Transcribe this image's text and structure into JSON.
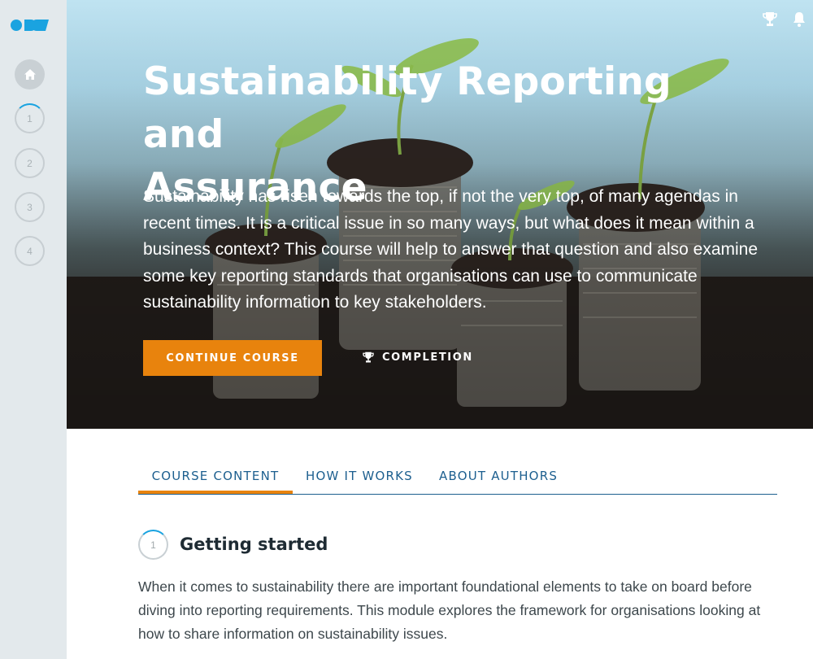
{
  "sidebar": {
    "logo": "logo",
    "home_icon": "home-icon",
    "steps": [
      "1",
      "2",
      "3",
      "4"
    ]
  },
  "hero": {
    "title_line1": "Sustainability Reporting and",
    "title_line2": "Assurance",
    "description": "Sustainability has risen towards the top, if not the very top, of many agendas in recent times. It is a critical issue in so many ways, but what does it mean within a business context? This course will help to answer that question and also examine some key reporting standards that organisations can use to communicate sustainability information to key stakeholders.",
    "continue_label": "CONTINUE COURSE",
    "completion_label": "COMPLETION",
    "top_icons": [
      "trophy-icon",
      "bell-icon"
    ]
  },
  "tabs": [
    {
      "label": "COURSE CONTENT",
      "active": true
    },
    {
      "label": "HOW IT WORKS",
      "active": false
    },
    {
      "label": "ABOUT AUTHORS",
      "active": false
    }
  ],
  "module": {
    "number": "1",
    "title": "Getting started",
    "description": "When it comes to sustainability there are important foundational elements to take on board before diving into reporting requirements. This module explores the framework for organisations looking at how to share information on sustainability issues."
  },
  "colors": {
    "accent": "#e8830d",
    "link": "#1d5f8f",
    "brand": "#1aa3e0",
    "sidebar": "#e3e9ec"
  }
}
